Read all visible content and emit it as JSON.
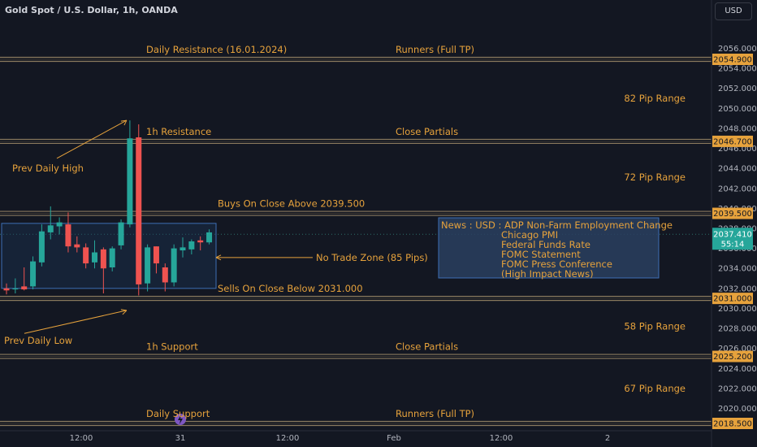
{
  "header": {
    "title": "Gold Spot / U.S. Dollar, 1h, OANDA",
    "currency": "USD"
  },
  "colors": {
    "background": "#131722",
    "bull": "#26a69a",
    "bear": "#ef5350",
    "level_line": "#8a7a5e",
    "label_orange": "#e6a23c",
    "zone_fill": "#1e3a5f",
    "price_badge": "#e6a23c",
    "current_badge": "#26a69a",
    "text": "#b2b5be"
  },
  "chart_data": {
    "type": "candlestick",
    "ylim": [
      2018.5,
      2057.5
    ],
    "y_ticks": [
      2056.0,
      2054.0,
      2052.0,
      2050.0,
      2048.0,
      2046.0,
      2044.0,
      2042.0,
      2040.0,
      2038.0,
      2036.0,
      2034.0,
      2032.0,
      2030.0,
      2028.0,
      2026.0,
      2024.0,
      2022.0,
      2020.0
    ],
    "x_labels": [
      "12:00",
      "31",
      "12:00",
      "Feb",
      "12:00",
      "2"
    ],
    "levels": [
      {
        "price": 2054.9,
        "badge": "2054.900",
        "left": "Daily Resistance (16.01.2024)",
        "right": "Runners (Full TP)"
      },
      {
        "price": 2046.7,
        "badge": "2046.700",
        "left": "1h Resistance",
        "right": "Close Partials"
      },
      {
        "price": 2039.5,
        "badge": "2039.500",
        "left": "Buys On Close Above 2039.500",
        "right": ""
      },
      {
        "price": 2031.0,
        "badge": "2031.000",
        "left": "Sells On Close Below 2031.000",
        "right": ""
      },
      {
        "price": 2025.2,
        "badge": "2025.200",
        "left": "1h Support",
        "right": "Close Partials"
      },
      {
        "price": 2018.5,
        "badge": "2018.500",
        "left": "Daily Support",
        "right": "Runners (Full TP)"
      }
    ],
    "ranges": [
      {
        "label": "82 Pip Range",
        "price": 2051.0
      },
      {
        "label": "72 Pip Range",
        "price": 2043.1
      },
      {
        "label": "58 Pip Range",
        "price": 2028.2
      },
      {
        "label": "67 Pip Range",
        "price": 2022.0
      }
    ],
    "current_price": {
      "value": 2037.41,
      "badge": "2037.410",
      "timer": "55:14"
    },
    "zone": {
      "label": "No Trade Zone (85 Pips)",
      "top": 2038.5,
      "bottom": 2032.0
    },
    "annotations": {
      "prev_high": "Prev Daily High",
      "prev_low": "Prev Daily Low"
    },
    "news": {
      "title": "News : USD : ADP Non-Farm Employment Change",
      "items": [
        "Chicago PMI",
        "Federal Funds Rate",
        "FOMC Statement",
        "FOMC Press Conference",
        "(High Impact News)"
      ]
    },
    "candles": [
      {
        "o": 2032.0,
        "h": 2032.5,
        "l": 2031.4,
        "c": 2031.8
      },
      {
        "o": 2031.9,
        "h": 2033.0,
        "l": 2031.5,
        "c": 2032.0
      },
      {
        "o": 2032.2,
        "h": 2034.1,
        "l": 2031.8,
        "c": 2031.9
      },
      {
        "o": 2032.2,
        "h": 2035.2,
        "l": 2031.9,
        "c": 2034.7
      },
      {
        "o": 2034.6,
        "h": 2038.4,
        "l": 2034.2,
        "c": 2037.7
      },
      {
        "o": 2037.6,
        "h": 2040.2,
        "l": 2036.9,
        "c": 2038.3
      },
      {
        "o": 2038.2,
        "h": 2039.1,
        "l": 2037.4,
        "c": 2038.6
      },
      {
        "o": 2038.4,
        "h": 2039.6,
        "l": 2035.6,
        "c": 2036.2
      },
      {
        "o": 2036.4,
        "h": 2037.2,
        "l": 2035.6,
        "c": 2036.1
      },
      {
        "o": 2036.1,
        "h": 2036.5,
        "l": 2034.0,
        "c": 2034.5
      },
      {
        "o": 2034.6,
        "h": 2036.8,
        "l": 2034.0,
        "c": 2035.6
      },
      {
        "o": 2035.9,
        "h": 2036.1,
        "l": 2031.5,
        "c": 2034.0
      },
      {
        "o": 2034.1,
        "h": 2036.2,
        "l": 2033.7,
        "c": 2036.0
      },
      {
        "o": 2036.3,
        "h": 2038.9,
        "l": 2035.9,
        "c": 2038.6
      },
      {
        "o": 2038.4,
        "h": 2048.8,
        "l": 2038.1,
        "c": 2047.0
      },
      {
        "o": 2047.1,
        "h": 2048.4,
        "l": 2031.3,
        "c": 2032.4
      },
      {
        "o": 2032.5,
        "h": 2036.4,
        "l": 2031.7,
        "c": 2036.1
      },
      {
        "o": 2036.2,
        "h": 2036.2,
        "l": 2033.5,
        "c": 2034.5
      },
      {
        "o": 2034.1,
        "h": 2034.5,
        "l": 2031.7,
        "c": 2032.6
      },
      {
        "o": 2032.6,
        "h": 2036.4,
        "l": 2032.2,
        "c": 2036.0
      },
      {
        "o": 2035.8,
        "h": 2037.1,
        "l": 2035.1,
        "c": 2036.1
      },
      {
        "o": 2035.9,
        "h": 2036.9,
        "l": 2035.4,
        "c": 2036.7
      },
      {
        "o": 2036.8,
        "h": 2037.2,
        "l": 2035.8,
        "c": 2036.6
      },
      {
        "o": 2036.6,
        "h": 2037.9,
        "l": 2036.4,
        "c": 2037.6
      }
    ]
  }
}
